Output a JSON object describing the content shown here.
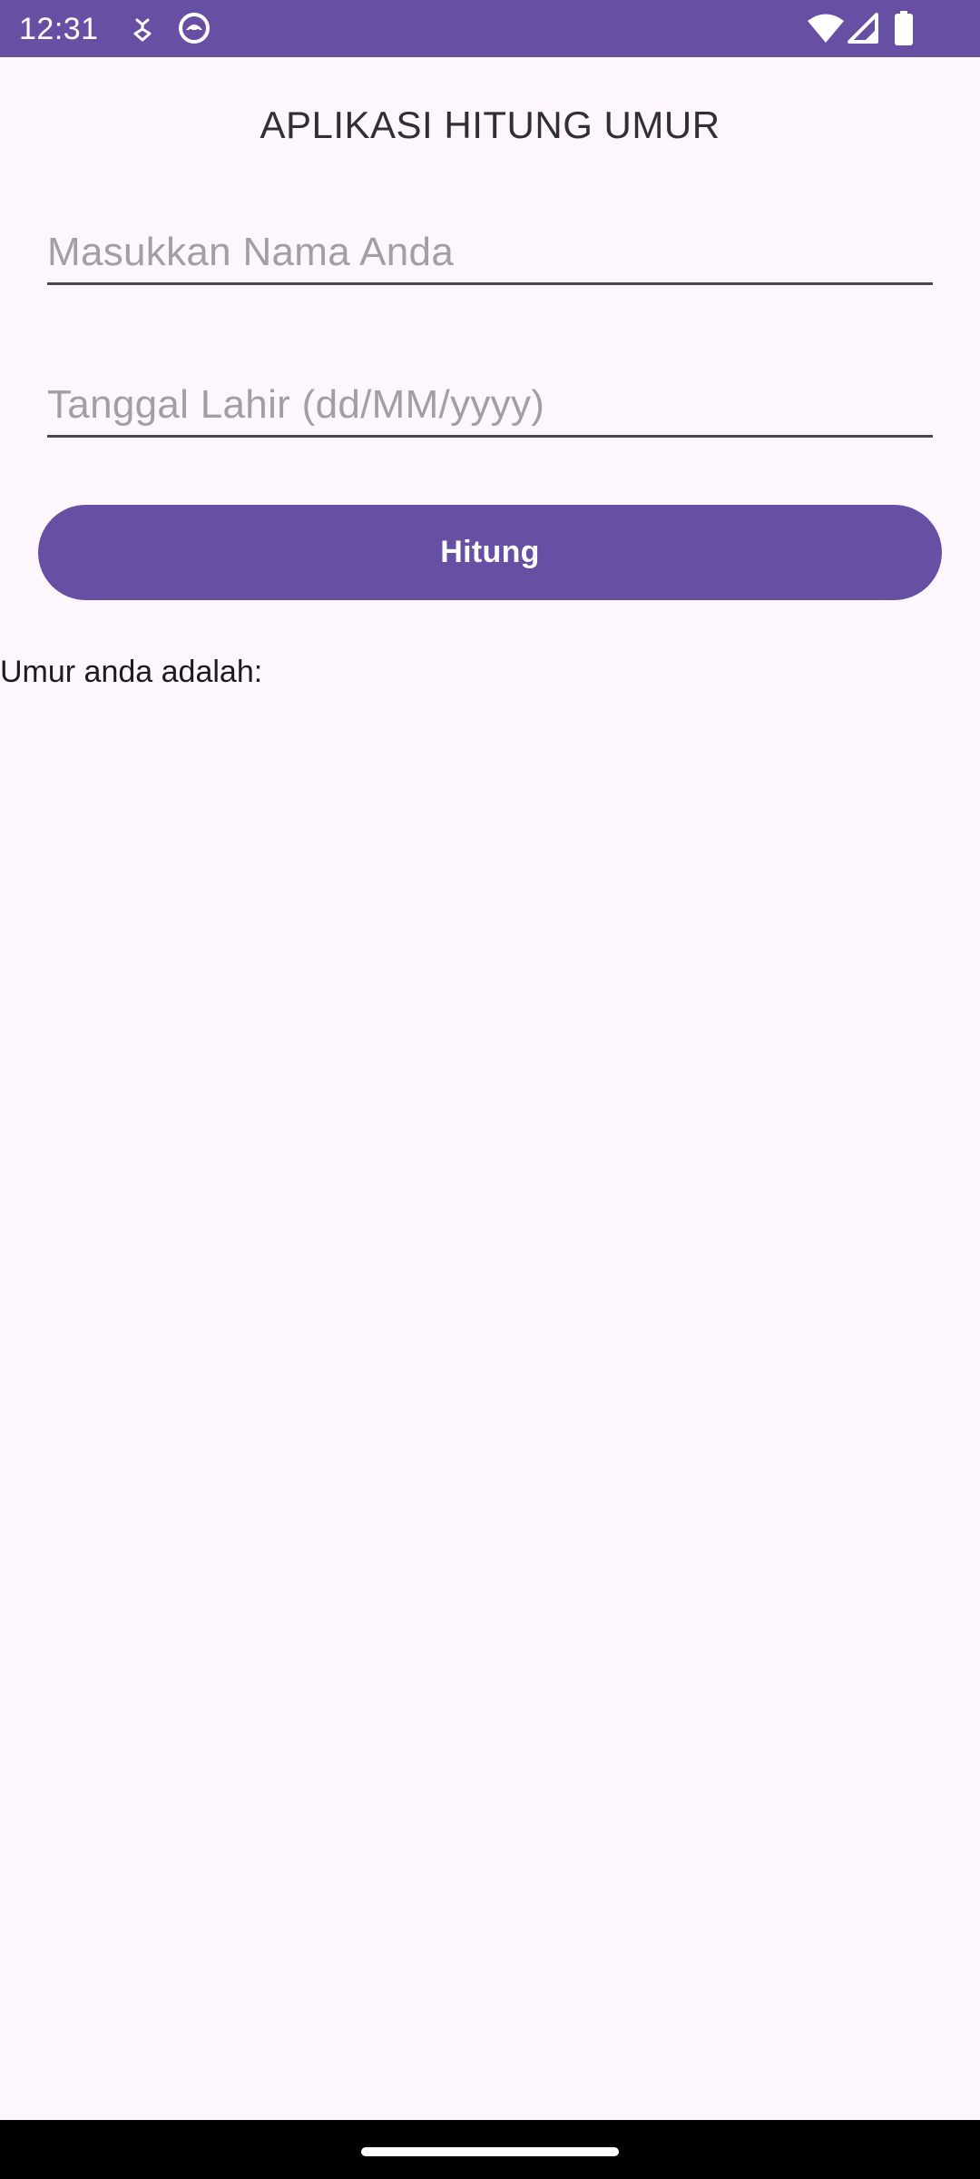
{
  "status_bar": {
    "time": "12:31",
    "background_color": "#6750A4",
    "left_icons": [
      "usb-debug-icon",
      "android-robot-icon"
    ],
    "right_icons": [
      "wifi-icon",
      "cellular-signal-icon",
      "battery-icon"
    ]
  },
  "app": {
    "title": "APLIKASI HITUNG UMUR"
  },
  "form": {
    "name_field": {
      "value": "",
      "placeholder": "Masukkan Nama Anda"
    },
    "birthdate_field": {
      "value": "",
      "placeholder": "Tanggal Lahir (dd/MM/yyyy)"
    },
    "calculate_button": {
      "label": "Hitung"
    }
  },
  "result": {
    "label": "Umur anda adalah:"
  },
  "colors": {
    "accent": "#6750A4",
    "background": "#FDF7FD",
    "text": "#1D1B20",
    "placeholder": "#A39DA8"
  }
}
